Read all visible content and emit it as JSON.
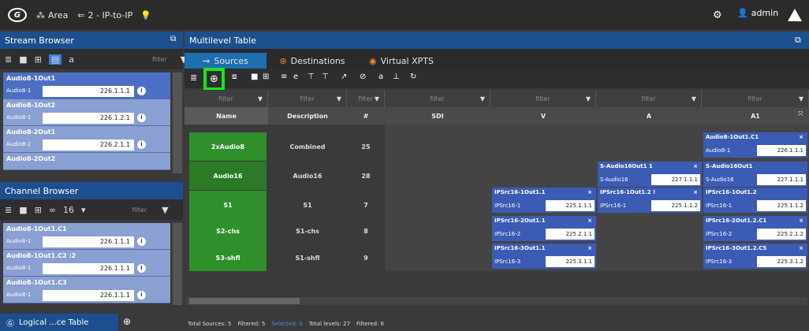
{
  "topbar": {
    "area_label": "Area",
    "route_label": "2 - IP-to-IP",
    "user": "admin"
  },
  "stream_browser": {
    "title": "Stream Browser",
    "filter_placeholder": "filter",
    "items": [
      {
        "title": "Audio8-1Out1",
        "sub": "Audio8-1",
        "ip": "226.1.1.1"
      },
      {
        "title": "Audio8-1Out2",
        "sub": "Audio8-1",
        "ip": "226.1.2.1"
      },
      {
        "title": "Audio8-2Out1",
        "sub": "Audio8-2",
        "ip": "226.2.1.1"
      },
      {
        "title": "Audio8-2Out2",
        "sub": "",
        "ip": ""
      }
    ]
  },
  "channel_browser": {
    "title": "Channel Browser",
    "count": "16",
    "filter_placeholder": "filter",
    "items": [
      {
        "title": "Audio8-1Out1.C1",
        "sub": "Audio8-1",
        "ip": "226.1.1.1"
      },
      {
        "title": "Audio8-1Out1.C2 :2",
        "sub": "Audio8-1",
        "ip": "226.1.1.1"
      },
      {
        "title": "Audio8-1Out1.C3",
        "sub": "Audio8-1",
        "ip": "226.1.1.1"
      }
    ]
  },
  "multilevel": {
    "title": "Multilevel Table",
    "tabs": [
      "Sources",
      "Destinations",
      "Virtual XPTS"
    ],
    "filter_placeholder": "filter",
    "columns": [
      "Name",
      "Description",
      "#",
      "SDI",
      "V",
      "A",
      "A1"
    ],
    "rows": [
      {
        "name": "2xAudio8",
        "desc": "Combined",
        "num": "25"
      },
      {
        "name": "Audio16",
        "desc": "Audio16",
        "num": "28"
      },
      {
        "name": "S1",
        "desc": "S1",
        "num": "7"
      },
      {
        "name": "S2-chs",
        "desc": "S1-chs",
        "num": "8"
      },
      {
        "name": "S3-shfl",
        "desc": "S1-shfl",
        "num": "9"
      }
    ],
    "chips": {
      "r0_a1": {
        "t": "Audio8-1Out1.C1",
        "x": "×",
        "s": "Audio8-1",
        "ip": "226.1.1.1"
      },
      "r1_a": {
        "t": "S-Audio16Out1  1",
        "x": "×",
        "s": "S-Audio16",
        "ip": "227.1.1.1"
      },
      "r1_a1": {
        "t": "S-Audio16Out1",
        "x": "",
        "s": "S-Audio16",
        "ip": "227.1.1.1"
      },
      "r2_v": {
        "t": "IPSrc16-1Out1.1",
        "x": "×",
        "s": "IPSrc16-1",
        "ip": "225.1.1.1"
      },
      "r2_a": {
        "t": "IPSrc16-1Out1.2  !",
        "x": "×",
        "s": "IPSrc16-1",
        "ip": "225.1.1.2"
      },
      "r2_a1": {
        "t": "IPSrc16-1Out1.2",
        "x": "",
        "s": "IPSrc16-1",
        "ip": "225.1.1.2"
      },
      "r3_v": {
        "t": "IPSrc16-2Out1.1",
        "x": "×",
        "s": "IPSrc16-2",
        "ip": "225.2.1.1"
      },
      "r3_a1": {
        "t": "IPSrc16-2Out1.2.C1",
        "x": "×",
        "s": "IPSrc16-2",
        "ip": "225.2.1.2"
      },
      "r4_v": {
        "t": "IPSrc16-3Out1.1",
        "x": "×",
        "s": "IPSrc16-3",
        "ip": "225.3.1.1"
      },
      "r4_a1": {
        "t": "IPSrc16-3Out1.2.C5",
        "x": "×",
        "s": "IPSrc16-3",
        "ip": "225.3.1.2"
      }
    },
    "status": {
      "total_sources": "Total Sources: 5",
      "filtered": "Filtered: 5",
      "selected": "Selected: 0",
      "total_levels": "Total levels: 27",
      "filtered_levels": "Filtered: 6"
    }
  },
  "bottom_tab": {
    "label": "Logical ...ce Table"
  },
  "colors": {
    "accent_blue": "#1d4f8f",
    "green": "#2f8f2a",
    "highlight": "#19e619"
  }
}
